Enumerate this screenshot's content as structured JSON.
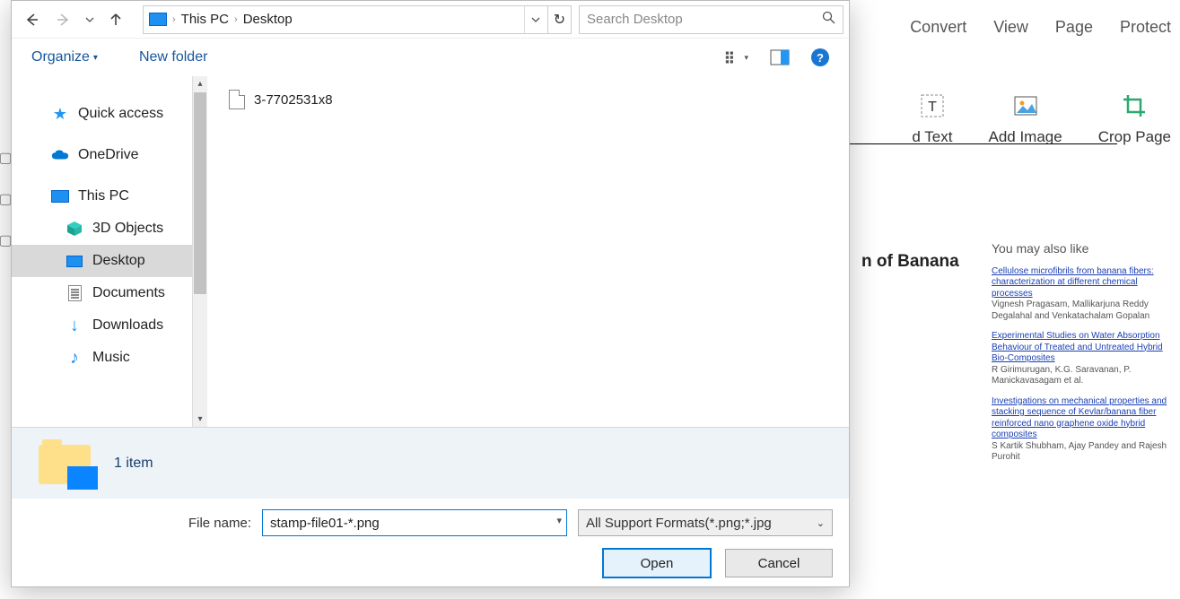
{
  "app": {
    "tabs": [
      "Convert",
      "View",
      "Page",
      "Protect"
    ],
    "tools": {
      "addText": "d Text",
      "addImage": "Add Image",
      "cropPage": "Crop Page"
    }
  },
  "pdf": {
    "title_fragment": "n of Banana",
    "youMayAlsoLike": "You may also like",
    "refs": [
      {
        "link": "Cellulose microfibrils from banana fibers: characterization at different chemical processes",
        "authors": "Vignesh Pragasam, Mallikarjuna Reddy Degalahal and Venkatachalam Gopalan"
      },
      {
        "link": "Experimental Studies on Water Absorption Behaviour of Treated and Untreated Hybrid Bio-Composites",
        "authors": "R Girimurugan, K.G. Saravanan, P. Manickavasagam et al."
      },
      {
        "link": "Investigations on mechanical properties and stacking sequence of Kevlar/banana fiber reinforced nano graphene oxide hybrid composites",
        "authors": "S Kartik Shubham, Ajay Pandey and Rajesh Purohit"
      }
    ]
  },
  "dialog": {
    "breadcrumb": {
      "root": "This PC",
      "leaf": "Desktop"
    },
    "search": {
      "placeholder": "Search Desktop"
    },
    "toolbar": {
      "organize": "Organize",
      "newFolder": "New folder"
    },
    "tree": {
      "quickAccess": "Quick access",
      "oneDrive": "OneDrive",
      "thisPC": "This PC",
      "children": [
        "3D Objects",
        "Desktop",
        "Documents",
        "Downloads",
        "Music"
      ],
      "selected": "Desktop"
    },
    "files": [
      {
        "name": "3-7702531x8"
      }
    ],
    "status": "1 item",
    "footer": {
      "fileNameLabel": "File name:",
      "fileNameValue": "stamp-file01-*.png",
      "filter": "All Support Formats(*.png;*.jpg",
      "open": "Open",
      "cancel": "Cancel"
    }
  }
}
